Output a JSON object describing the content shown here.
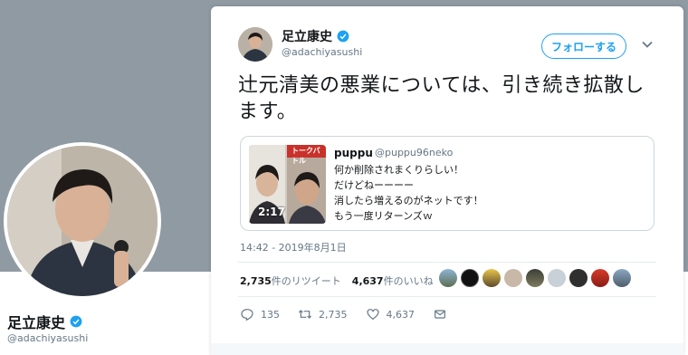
{
  "profile": {
    "name": "足立康史",
    "handle": "@adachiyasushi"
  },
  "tweet": {
    "author_name": "足立康史",
    "author_handle": "@adachiyasushi",
    "follow_label": "フォローする",
    "text": "辻元清美の悪業については、引き続き拡散します。",
    "timestamp": "14:42 - 2019年8月1日",
    "retweets_count": "2,735",
    "retweets_label": "件のリツイート",
    "likes_count": "4,637",
    "likes_label": "件のいいね",
    "reply_count": "135",
    "retweet_action_count": "2,735",
    "like_action_count": "4,637"
  },
  "quote": {
    "name": "puppu",
    "handle": "@puppu96neko",
    "lines": [
      "何か削除されまくりらしい！",
      "だけどねーーーー",
      "消したら増えるのがネットです！",
      "もう一度リターンズｗ"
    ],
    "video_duration": "2:17",
    "thumb_caption": "トークバトル"
  },
  "colors": {
    "accent": "#1da1f2",
    "muted_text": "#657786",
    "border": "#ccd6dd",
    "header_bg": "#8f9aa3"
  },
  "icons": [
    "verified-badge-icon",
    "chevron-down-icon",
    "reply-icon",
    "retweet-icon",
    "like-icon",
    "message-icon"
  ]
}
